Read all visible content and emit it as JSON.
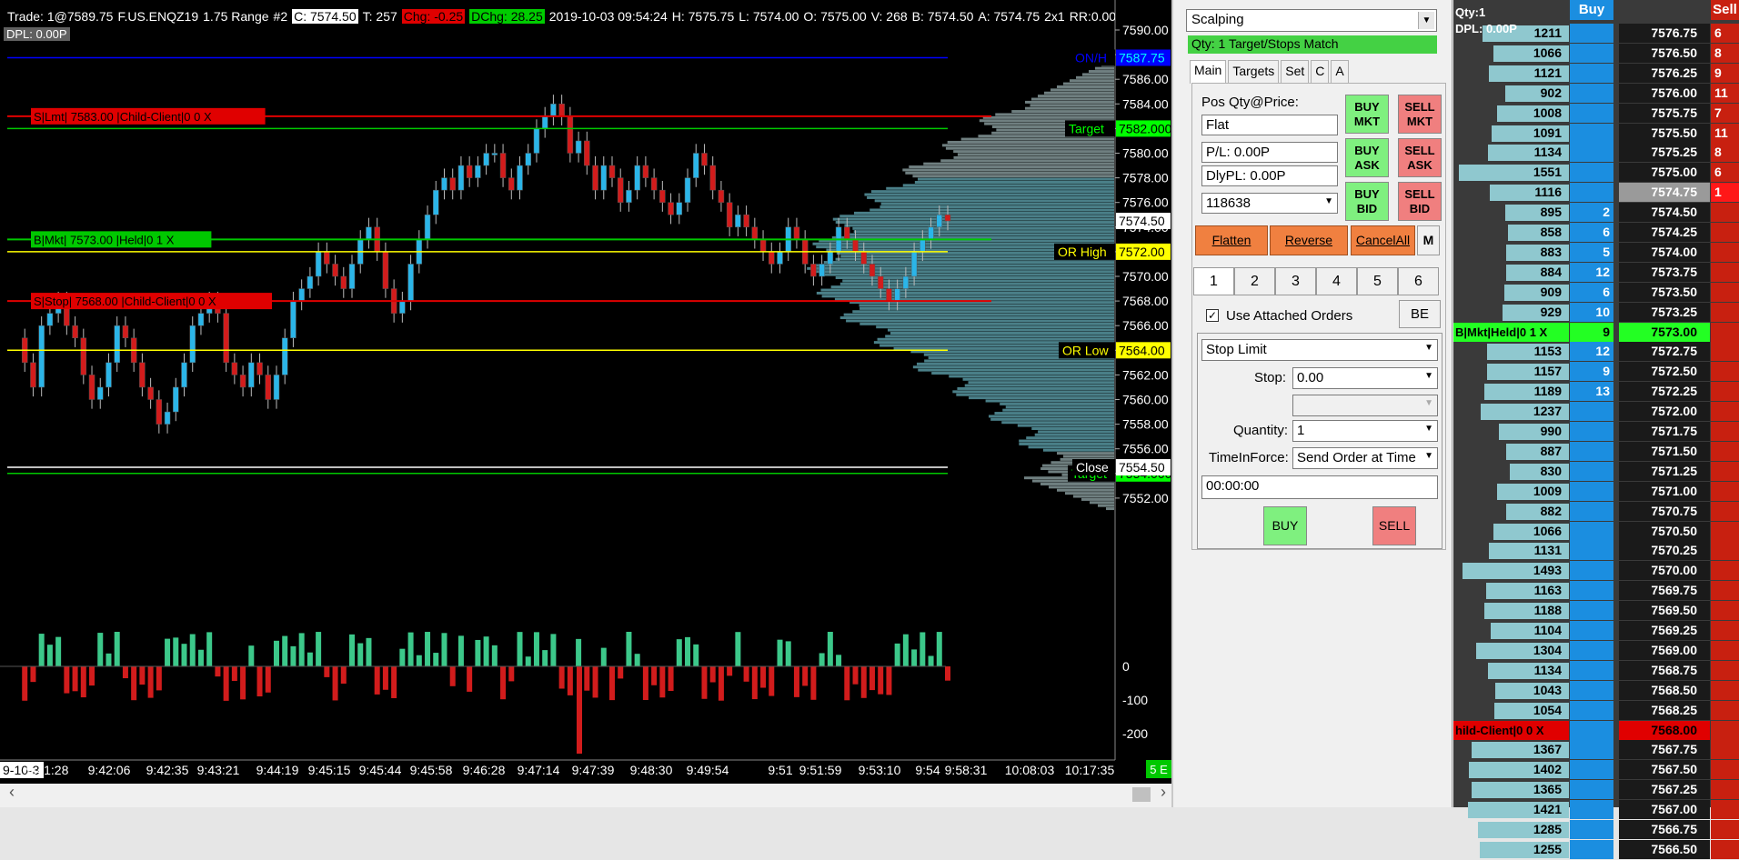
{
  "header": {
    "trade": "Trade: 1@7589.75",
    "symbol": "F.US.ENQZ19",
    "range": "1.75 Range",
    "num": "#2",
    "c_label": "C: 7574.50",
    "t_label": "T: 257",
    "chg_label": "Chg: -0.25",
    "dchg_label": "DChg: 28.25",
    "datetime": "2019-10-03 09:54:24",
    "hl": "H: 7575.75",
    "l": "L: 7574.00",
    "o": "O: 7575.00",
    "v": "V: 268",
    "b": "B: 7574.50",
    "a": "A: 7574.75",
    "rr": "2x1",
    "rr_label": "RR:0.00 B",
    "dpl": "DPL: 0.00P"
  },
  "chart": {
    "price_axis": [
      "7590.00",
      "7588.00",
      "7586.00",
      "7584.00",
      "7582.00",
      "7580.00",
      "7578.00",
      "7576.00",
      "7574.00",
      "7572.00",
      "7570.00",
      "7568.00",
      "7566.00",
      "7564.00",
      "7562.00",
      "7560.00",
      "7558.00",
      "7556.00",
      "7554.00",
      "7552.00"
    ],
    "vol_axis": [
      "0",
      "-100",
      "-200"
    ],
    "time_axis": [
      "9-10-3",
      "9:41:28",
      "9:42:06",
      "9:42:35",
      "9:43:21",
      "9:44:19",
      "9:45:15",
      "9:45:44",
      "9:45:58",
      "9:46:28",
      "9:47:14",
      "9:47:39",
      "9:48:30",
      "9:49:54",
      "9:51",
      "9:51:59",
      "9:53:10",
      "9:54",
      "9:58:31",
      "10:08:03",
      "10:17:35"
    ],
    "levels": {
      "on_high": {
        "label": "ON/H",
        "value": "7587.75",
        "color": "#0000ff"
      },
      "target_top": {
        "label": "Target",
        "value": "7582.000",
        "color": "#00c800"
      },
      "or_high": {
        "label": "OR High",
        "value": "7572.00",
        "color": "#ffff00"
      },
      "or_low": {
        "label": "OR Low",
        "value": "7564.00",
        "color": "#ffff00"
      },
      "close": {
        "label": "Close",
        "value": "7554.50",
        "color": "#ffffff"
      },
      "target_bot": {
        "label": "Target",
        "value": "7554.000",
        "color": "#00c800"
      },
      "last_price": "7574.50",
      "five_e": "5 E"
    },
    "orders": [
      {
        "text": "S|Lmt| 7583.00 |Child-Client|0 0 X",
        "price": 7583.0,
        "color": "#e00000"
      },
      {
        "text": "B|Mkt| 7573.00 |Held|0 1 X",
        "price": 7573.0,
        "color": "#00c800"
      },
      {
        "text": "S|Stop| 7568.00 |Child-Client|0 0 X",
        "price": 7568.0,
        "color": "#e00000"
      }
    ]
  },
  "dom": {
    "strategy": "Scalping",
    "qty_bar": "Qty: 1 Target/Stops Match",
    "tabs": [
      "Main",
      "Targets",
      "Set",
      "C",
      "A"
    ],
    "pos_label": "Pos Qty@Price:",
    "pos_value": "Flat",
    "pl": "P/L: 0.00P",
    "dlypl": "DlyPL: 0.00P",
    "account": "118638",
    "buy_mkt": "BUY MKT",
    "sell_mkt": "SELL MKT",
    "buy_ask": "BUY ASK",
    "sell_ask": "SELL ASK",
    "buy_bid": "BUY BID",
    "sell_bid": "SELL BID",
    "flatten": "Flatten",
    "reverse": "Reverse",
    "cancel_all": "CancelAll",
    "m": "M",
    "nums": [
      "1",
      "2",
      "3",
      "4",
      "5",
      "6"
    ],
    "use_attached": "Use Attached Orders",
    "be": "BE",
    "order_type": "Stop Limit",
    "stop_label": "Stop:",
    "stop_value": "0.00",
    "quantity_label": "Quantity:",
    "quantity_value": "1",
    "tif_label": "TimeInForce:",
    "tif_value": "Send Order at Time",
    "time_value": "00:00:00",
    "buy": "BUY",
    "sell": "SELL"
  },
  "ladder": {
    "qty_label": "Qty:1",
    "dpl_label": "DPL: 0.00P",
    "buy_header": "Buy",
    "sell_header": "Sell",
    "rows": [
      {
        "qty": "1211",
        "bid": "",
        "price": "7576.75",
        "ask": "6"
      },
      {
        "qty": "1066",
        "bid": "",
        "price": "7576.50",
        "ask": "8"
      },
      {
        "qty": "1121",
        "bid": "",
        "price": "7576.25",
        "ask": "9"
      },
      {
        "qty": "902",
        "bid": "",
        "price": "7576.00",
        "ask": "11"
      },
      {
        "qty": "1008",
        "bid": "",
        "price": "7575.75",
        "ask": "7"
      },
      {
        "qty": "1091",
        "bid": "",
        "price": "7575.50",
        "ask": "11"
      },
      {
        "qty": "1134",
        "bid": "",
        "price": "7575.25",
        "ask": "8"
      },
      {
        "qty": "1551",
        "bid": "",
        "price": "7575.00",
        "ask": "6"
      },
      {
        "qty": "1116",
        "bid": "",
        "price": "7574.75",
        "ask": "1",
        "last": true
      },
      {
        "qty": "895",
        "bid": "2",
        "price": "7574.50",
        "ask": ""
      },
      {
        "qty": "858",
        "bid": "6",
        "price": "7574.25",
        "ask": ""
      },
      {
        "qty": "883",
        "bid": "5",
        "price": "7574.00",
        "ask": ""
      },
      {
        "qty": "884",
        "bid": "12",
        "price": "7573.75",
        "ask": ""
      },
      {
        "qty": "909",
        "bid": "6",
        "price": "7573.50",
        "ask": ""
      },
      {
        "qty": "929",
        "bid": "10",
        "price": "7573.25",
        "ask": ""
      },
      {
        "qty": "B|Mkt|Held|0  1  X",
        "bid": "9",
        "price": "7573.00",
        "ask": "",
        "order": "buy"
      },
      {
        "qty": "1153",
        "bid": "12",
        "price": "7572.75",
        "ask": ""
      },
      {
        "qty": "1157",
        "bid": "9",
        "price": "7572.50",
        "ask": ""
      },
      {
        "qty": "1189",
        "bid": "13",
        "price": "7572.25",
        "ask": ""
      },
      {
        "qty": "1237",
        "bid": "",
        "price": "7572.00",
        "ask": ""
      },
      {
        "qty": "990",
        "bid": "",
        "price": "7571.75",
        "ask": ""
      },
      {
        "qty": "887",
        "bid": "",
        "price": "7571.50",
        "ask": ""
      },
      {
        "qty": "830",
        "bid": "",
        "price": "7571.25",
        "ask": ""
      },
      {
        "qty": "1009",
        "bid": "",
        "price": "7571.00",
        "ask": ""
      },
      {
        "qty": "882",
        "bid": "",
        "price": "7570.75",
        "ask": ""
      },
      {
        "qty": "1066",
        "bid": "",
        "price": "7570.50",
        "ask": ""
      },
      {
        "qty": "1131",
        "bid": "",
        "price": "7570.25",
        "ask": ""
      },
      {
        "qty": "1493",
        "bid": "",
        "price": "7570.00",
        "ask": ""
      },
      {
        "qty": "1163",
        "bid": "",
        "price": "7569.75",
        "ask": ""
      },
      {
        "qty": "1188",
        "bid": "",
        "price": "7569.50",
        "ask": ""
      },
      {
        "qty": "1104",
        "bid": "",
        "price": "7569.25",
        "ask": ""
      },
      {
        "qty": "1304",
        "bid": "",
        "price": "7569.00",
        "ask": ""
      },
      {
        "qty": "1134",
        "bid": "",
        "price": "7568.75",
        "ask": ""
      },
      {
        "qty": "1043",
        "bid": "",
        "price": "7568.50",
        "ask": ""
      },
      {
        "qty": "1054",
        "bid": "",
        "price": "7568.25",
        "ask": ""
      },
      {
        "qty": "hild-Client|0  0  X",
        "bid": "",
        "price": "7568.00",
        "ask": "",
        "order": "sell"
      },
      {
        "qty": "1367",
        "bid": "",
        "price": "7567.75",
        "ask": ""
      },
      {
        "qty": "1402",
        "bid": "",
        "price": "7567.50",
        "ask": ""
      },
      {
        "qty": "1365",
        "bid": "",
        "price": "7567.25",
        "ask": ""
      },
      {
        "qty": "1421",
        "bid": "",
        "price": "7567.00",
        "ask": ""
      },
      {
        "qty": "1285",
        "bid": "",
        "price": "7566.75",
        "ask": ""
      },
      {
        "qty": "1255",
        "bid": "",
        "price": "7566.50",
        "ask": ""
      }
    ]
  }
}
